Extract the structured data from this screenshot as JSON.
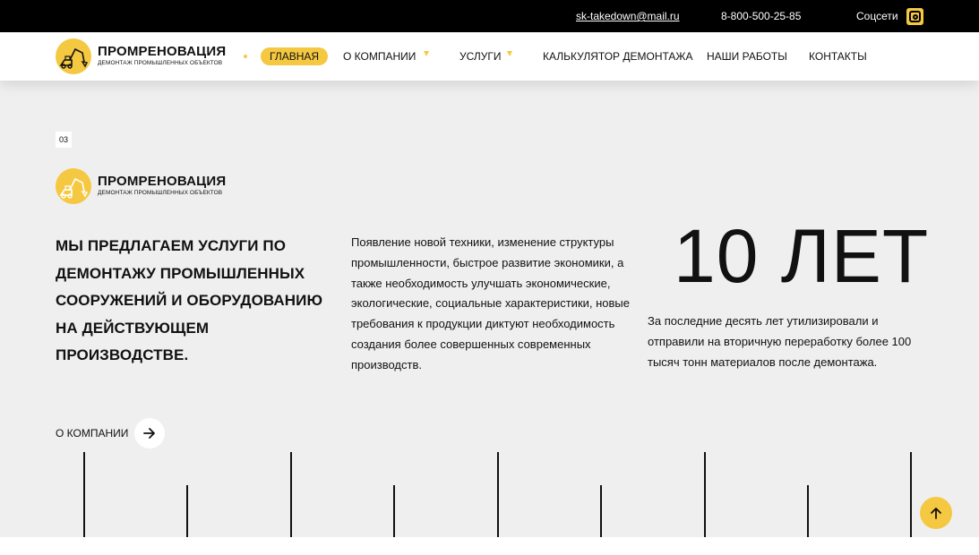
{
  "topbar": {
    "email": "sk-takedown@mail.ru",
    "phone": "8-800-500-25-85",
    "social_label": "Соцсети",
    "social_icon": "instagram-icon"
  },
  "brand": {
    "name": "ПРОМРЕНОВАЦИЯ",
    "tagline": "ДЕМОНТАЖ ПРОМЫШЛЕННЫХ ОБЪЕКТОВ",
    "accent": "#f5c842"
  },
  "nav": {
    "items": [
      {
        "label": "ГЛАВНАЯ",
        "active": true
      },
      {
        "label": "О КОМПАНИИ",
        "dropdown": true
      },
      {
        "label": "УСЛУГИ",
        "dropdown": true
      },
      {
        "label": "КАЛЬКУЛЯТОР ДЕМОНТАЖА"
      },
      {
        "label": "НАШИ РАБОТЫ"
      },
      {
        "label": "КОНТАКТЫ"
      }
    ]
  },
  "section": {
    "number": "03",
    "headline": "МЫ ПРЕДЛАГАЕМ УСЛУГИ ПО ДЕМОНТАЖУ ПРОМЫШЛЕННЫХ СООРУЖЕНИЙ И ОБОРУДОВАНИЮ НА ДЕЙСТВУЮЩЕМ ПРОИЗВОДСТВЕ.",
    "paragraph": "Появление новой техники, изменение структуры промышленности, быстрое развитие экономики, а также необходимость улучшать экономические, экологические, социальные характеристики, новые требования к продукции диктуют необходимость создания более совершенных современных производств.",
    "stat_value": "10 ЛЕТ",
    "stat_description": "За последние десять лет утилизировали и отправили на вторичную переработку более 100 тысяч тонн материалов после демонтажа.",
    "more_label": "О КОМПАНИИ",
    "more_icon": "arrow-right-icon"
  },
  "scroll_top_icon": "arrow-up-icon"
}
